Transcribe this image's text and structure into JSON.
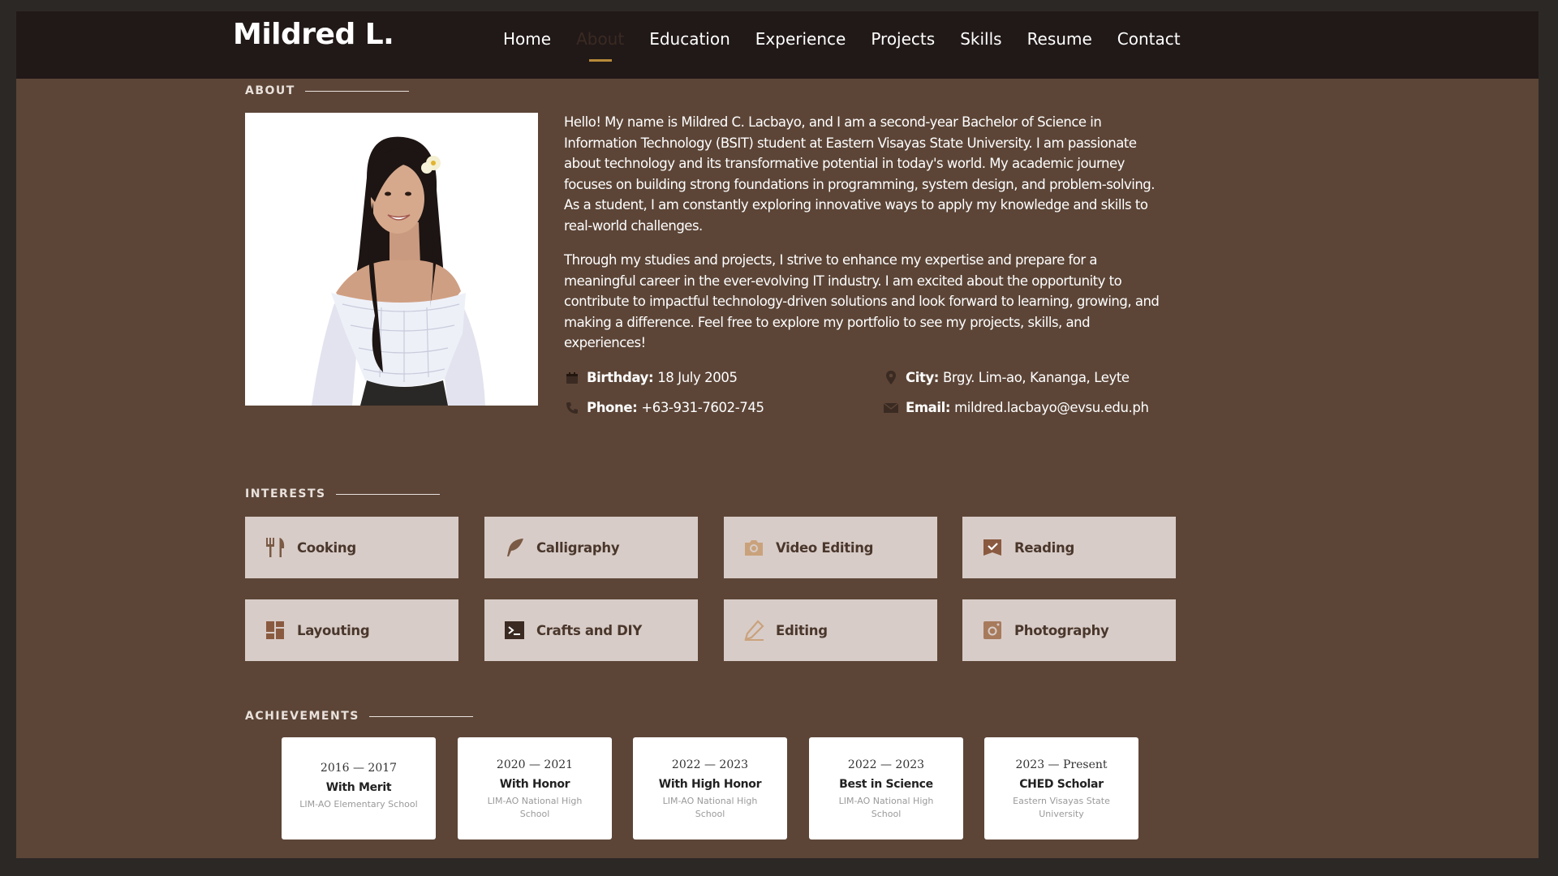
{
  "header": {
    "logo": "Mildred L.",
    "nav": [
      "Home",
      "About",
      "Education",
      "Experience",
      "Projects",
      "Skills",
      "Resume",
      "Contact"
    ],
    "active": "About"
  },
  "about": {
    "heading": "ABOUT",
    "paragraphs": [
      "Hello! My name is Mildred C. Lacbayo, and I am a second-year Bachelor of Science in Information Technology (BSIT) student at Eastern Visayas State University. I am passionate about technology and its transformative potential in today's world. My academic journey focuses on building strong foundations in programming, system design, and problem-solving. As a student, I am constantly exploring innovative ways to apply my knowledge and skills to real-world challenges.",
      "Through my studies and projects, I strive to enhance my expertise and prepare for a meaningful career in the ever-evolving IT industry. I am excited about the opportunity to contribute to impactful technology-driven solutions and look forward to learning, growing, and making a difference. Feel free to explore my portfolio to see my projects, skills, and experiences!"
    ],
    "birthday_label": "Birthday:",
    "birthday": "18 July 2005",
    "city_label": "City:",
    "city": "Brgy. Lim-ao, Kananga, Leyte",
    "phone_label": "Phone:",
    "phone": "+63-931-7602-745",
    "email_label": "Email:",
    "email": "mildred.lacbayo@evsu.edu.ph"
  },
  "interests": {
    "heading": "INTERESTS",
    "items": [
      {
        "label": "Cooking",
        "icon": "utensils-icon"
      },
      {
        "label": "Calligraphy",
        "icon": "feather-icon"
      },
      {
        "label": "Video Editing",
        "icon": "camera-icon"
      },
      {
        "label": "Reading",
        "icon": "bookmark-check-icon"
      },
      {
        "label": "Layouting",
        "icon": "dashboard-icon"
      },
      {
        "label": "Crafts and DIY",
        "icon": "terminal-icon"
      },
      {
        "label": "Editing",
        "icon": "pencil-icon"
      },
      {
        "label": "Photography",
        "icon": "instagram-icon"
      }
    ]
  },
  "achievements": {
    "heading": "ACHIEVEMENTS",
    "items": [
      {
        "years": "2016 — 2017",
        "title": "With Merit",
        "school": "LIM-AO Elementary School"
      },
      {
        "years": "2020 — 2021",
        "title": "With Honor",
        "school": "LIM-AO National High School"
      },
      {
        "years": "2022 — 2023",
        "title": "With High Honor",
        "school": "LIM-AO National High School"
      },
      {
        "years": "2022 — 2023",
        "title": "Best in Science",
        "school": "LIM-AO National High School"
      },
      {
        "years": "2023 — Present",
        "title": "CHED Scholar",
        "school": "Eastern Visayas State University"
      }
    ]
  },
  "colors": {
    "background": "#5c4537",
    "header": "#211918",
    "card": "#d8ccc8",
    "accent": "#b88a3a"
  }
}
